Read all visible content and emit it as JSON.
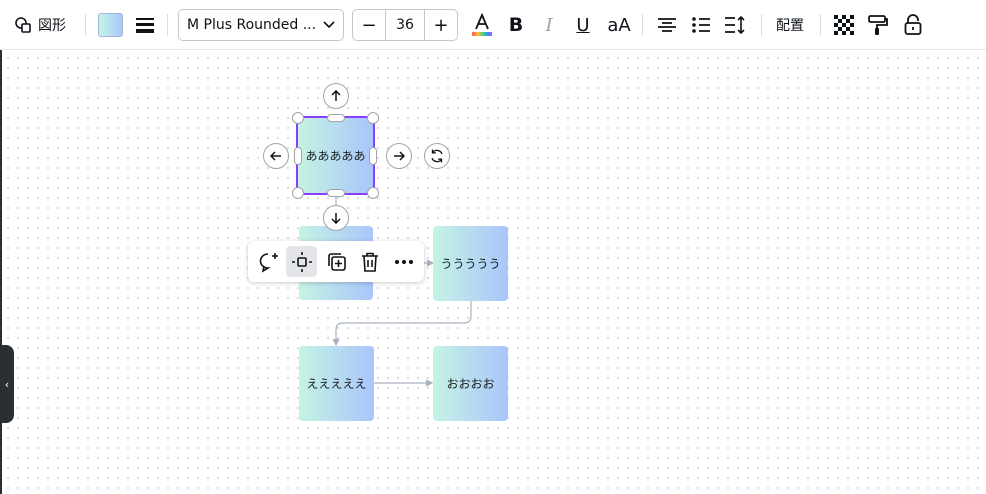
{
  "toolbar": {
    "shapes_label": "図形",
    "font_name": "M Plus Rounded ...",
    "font_size": "36",
    "minus_label": "−",
    "plus_label": "+",
    "bold_label": "B",
    "italic_label": "I",
    "underline_label": "U",
    "case_label": "aA",
    "position_label": "配置",
    "fill_gradient": [
      "#c5f3e4",
      "#a8c8fb"
    ],
    "text_color_bar": "rainbow"
  },
  "canvas": {
    "nodes": [
      {
        "id": "a",
        "label": "あああああ",
        "selected": true
      },
      {
        "id": "b",
        "label": ""
      },
      {
        "id": "c",
        "label": "ううううう"
      },
      {
        "id": "d",
        "label": "えええええ"
      },
      {
        "id": "e",
        "label": "おおおお"
      }
    ],
    "selection_color": "#8b3dff",
    "connector_color": "#a8b2bf"
  },
  "icons": {
    "shapes": "shapes-icon",
    "stroke": "stroke-weight-icon",
    "align": "text-align-center-icon",
    "list": "bullet-list-icon",
    "spacing": "line-spacing-icon",
    "transparency": "transparency-icon",
    "paint": "paint-format-icon",
    "lock": "lock-icon",
    "comment": "add-comment-icon",
    "move": "move-icon",
    "duplicate": "duplicate-icon",
    "delete": "delete-icon",
    "more": "more-icon"
  },
  "side_panel_toggle": "‹"
}
